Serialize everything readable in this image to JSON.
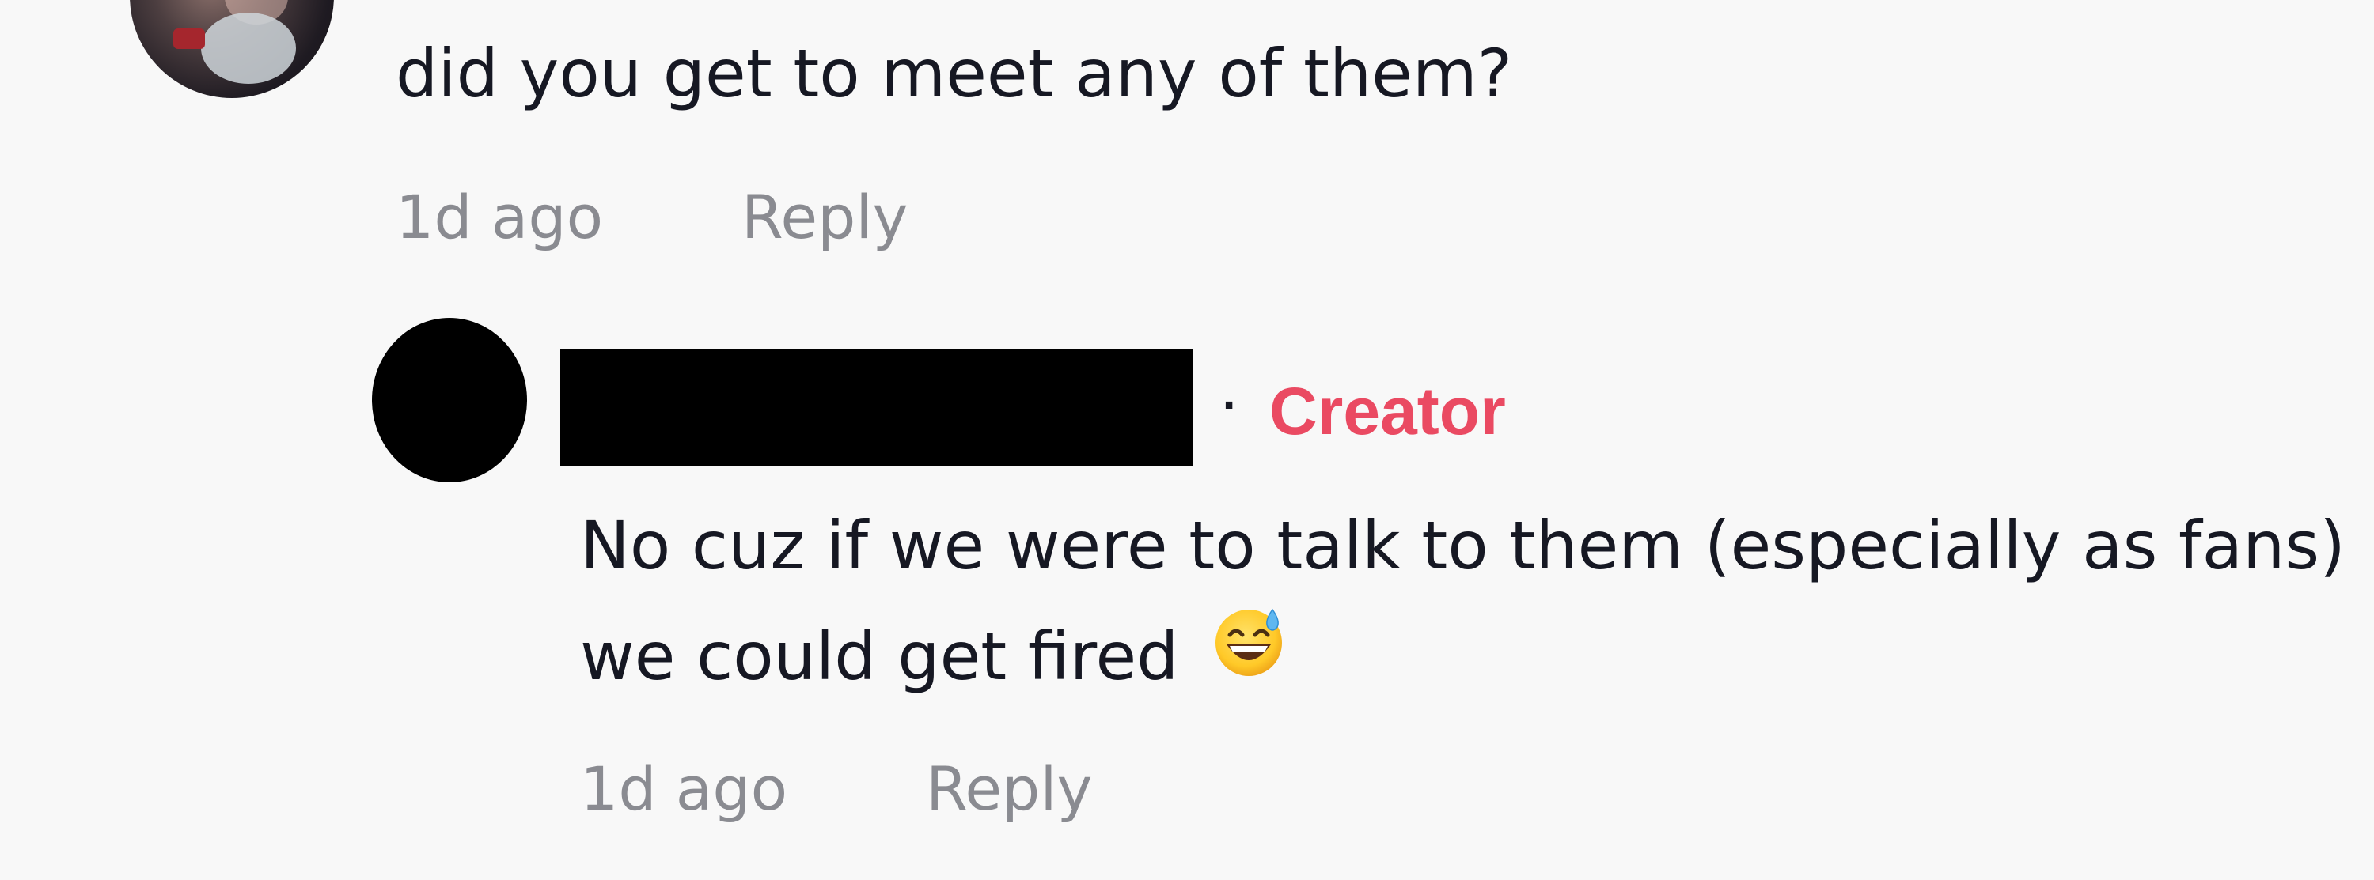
{
  "parent_comment": {
    "text": "did you get to meet any of them?",
    "time": "1d ago",
    "reply_label": "Reply"
  },
  "reply_comment": {
    "badge": "Creator",
    "separator": "·",
    "text": "No cuz if we were to talk to them (especially as fans) we could get fired",
    "emoji": "grinning-face-with-sweat",
    "time": "1d ago",
    "reply_label": "Reply"
  },
  "colors": {
    "background": "#f8f8f8",
    "text": "#161823",
    "meta": "#8a8b91",
    "creator_badge": "#ea4a62"
  }
}
